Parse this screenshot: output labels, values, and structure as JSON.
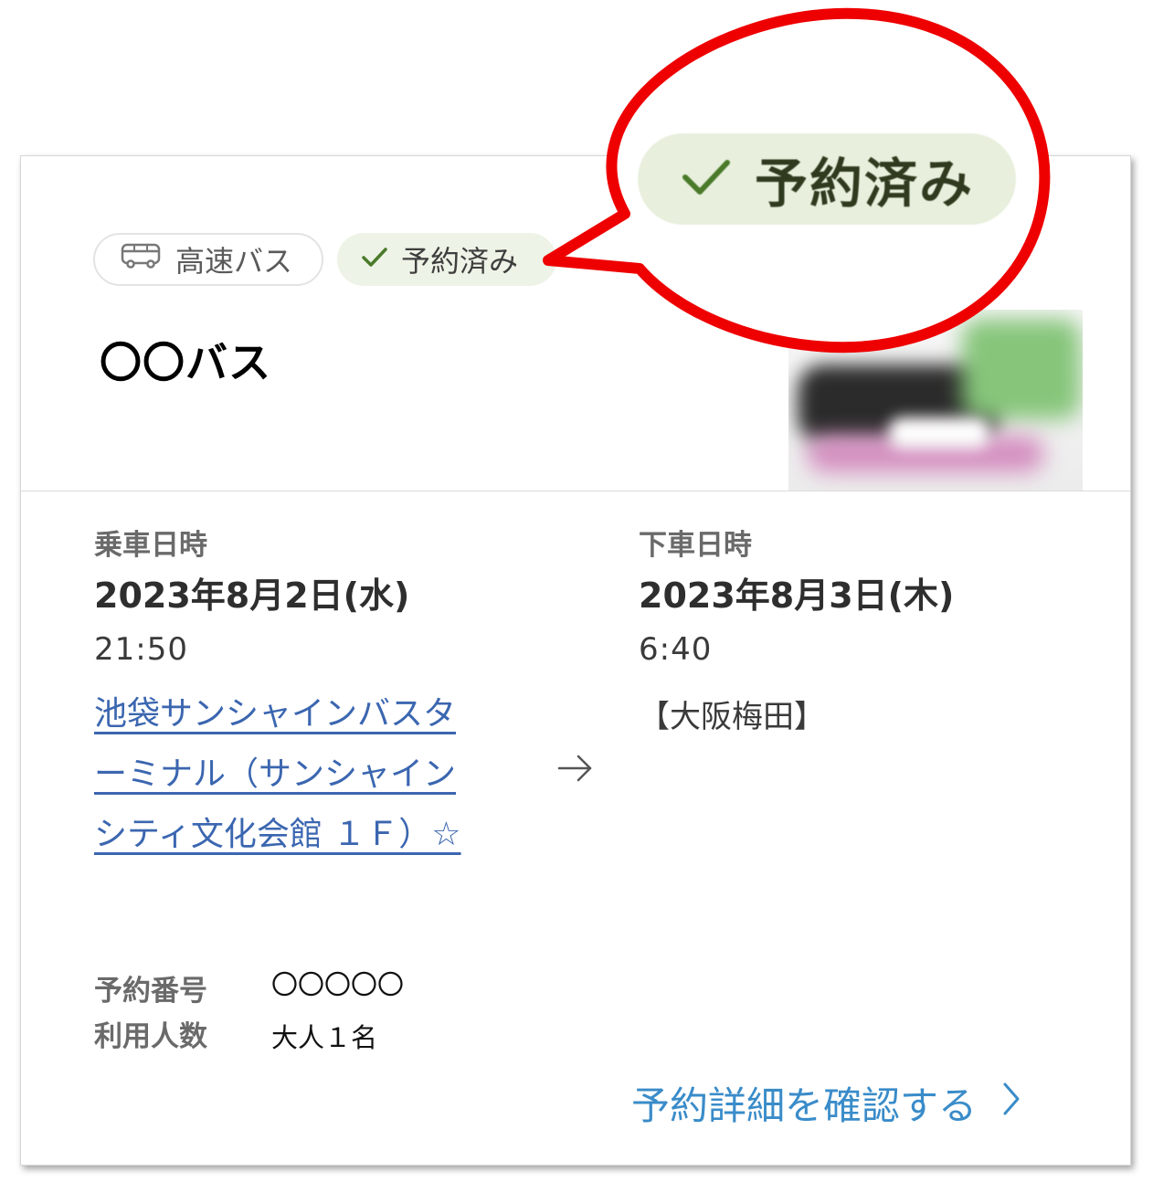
{
  "card": {
    "tags": {
      "bus_type": "高速バス",
      "status": "予約済み"
    },
    "title": "〇〇バス",
    "thumbnail": "bus-photo"
  },
  "departure": {
    "label": "乗車日時",
    "date": "2023年8月2日(水)",
    "time": "21:50",
    "stop_lines": [
      "池袋サンシャインバスタ",
      "ーミナル（サンシャイン",
      "シティ文化会館 １Ｆ）☆"
    ]
  },
  "arrival": {
    "label": "下車日時",
    "date": "2023年8月3日(木)",
    "time": "6:40",
    "stop": "【大阪梅田】"
  },
  "info": {
    "reservation_number_label": "予約番号",
    "reservation_number": "〇〇〇〇〇",
    "passengers_label": "利用人数",
    "passengers": "大人１名"
  },
  "detail_link": "予約詳細を確認する",
  "callout": {
    "status": "予約済み"
  },
  "colors": {
    "link": "#3b66b0",
    "detail_link": "#3a8cc9",
    "status_bg": "#edf3e6",
    "check": "#4a7a2a",
    "callout_outline": "#ee0000"
  }
}
